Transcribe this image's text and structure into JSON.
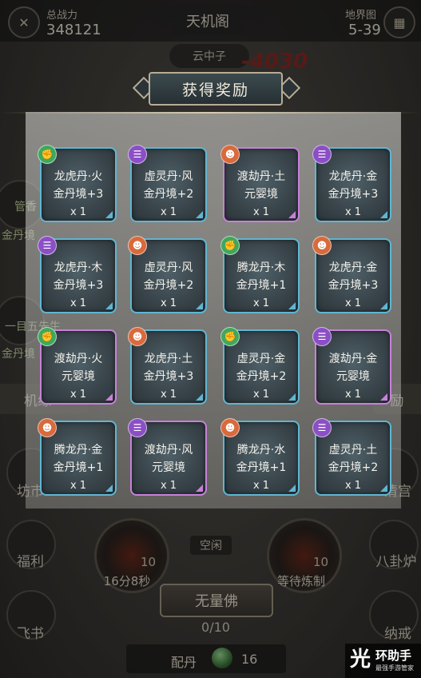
{
  "header": {
    "power_label": "总战力",
    "power_value": "348121",
    "title": "天机阁",
    "map_label": "地界图",
    "map_value": "5-39"
  },
  "scene": {
    "npc_name": "云中子",
    "damage": "-4030",
    "left_label_1": "管香",
    "left_label_2": "金丹境",
    "left_label_3": "一目五先生",
    "left_label_4": "金丹境",
    "bar_left": "机缘",
    "bar_right": "励",
    "side_left": [
      "坊市",
      "福利",
      "飞书"
    ],
    "side_right": [
      "清宫",
      "八卦炉",
      "纳戒"
    ],
    "furnace_left_count": "10",
    "furnace_left_timer": "16分8秒",
    "furnace_right_count": "10",
    "furnace_right_status": "等待炼制",
    "idle_label": "空闲",
    "action_button": "无量佛",
    "progress": "0/10",
    "peidan_label": "配丹",
    "peidan_count": "16"
  },
  "watermark": {
    "main": "环助手",
    "sub": "最强手游管家"
  },
  "reward": {
    "title": "获得奖励",
    "items": [
      {
        "name": "龙虎丹·火",
        "realm": "金丹境+3",
        "qty": "x 1",
        "frame": "blue",
        "badge": "green"
      },
      {
        "name": "虚灵丹·风",
        "realm": "金丹境+2",
        "qty": "x 1",
        "frame": "blue",
        "badge": "purple"
      },
      {
        "name": "渡劫丹·土",
        "realm": "元婴境",
        "qty": "x 1",
        "frame": "purple",
        "badge": "orange"
      },
      {
        "name": "龙虎丹·金",
        "realm": "金丹境+3",
        "qty": "x 1",
        "frame": "blue",
        "badge": "purple"
      },
      {
        "name": "龙虎丹·木",
        "realm": "金丹境+3",
        "qty": "x 1",
        "frame": "blue",
        "badge": "purple"
      },
      {
        "name": "虚灵丹·风",
        "realm": "金丹境+2",
        "qty": "x 1",
        "frame": "blue",
        "badge": "orange"
      },
      {
        "name": "腾龙丹·木",
        "realm": "金丹境+1",
        "qty": "x 1",
        "frame": "blue",
        "badge": "green"
      },
      {
        "name": "龙虎丹·金",
        "realm": "金丹境+3",
        "qty": "x 1",
        "frame": "blue",
        "badge": "orange"
      },
      {
        "name": "渡劫丹·火",
        "realm": "元婴境",
        "qty": "x 1",
        "frame": "purple",
        "badge": "green"
      },
      {
        "name": "龙虎丹·土",
        "realm": "金丹境+3",
        "qty": "x 1",
        "frame": "blue",
        "badge": "orange"
      },
      {
        "name": "虚灵丹·金",
        "realm": "金丹境+2",
        "qty": "x 1",
        "frame": "blue",
        "badge": "green"
      },
      {
        "name": "渡劫丹·金",
        "realm": "元婴境",
        "qty": "x 1",
        "frame": "purple",
        "badge": "purple"
      },
      {
        "name": "腾龙丹·金",
        "realm": "金丹境+1",
        "qty": "x 1",
        "frame": "blue",
        "badge": "orange"
      },
      {
        "name": "渡劫丹·风",
        "realm": "元婴境",
        "qty": "x 1",
        "frame": "purple",
        "badge": "purple"
      },
      {
        "name": "腾龙丹·水",
        "realm": "金丹境+1",
        "qty": "x 1",
        "frame": "blue",
        "badge": "orange"
      },
      {
        "name": "虚灵丹·土",
        "realm": "金丹境+2",
        "qty": "x 1",
        "frame": "blue",
        "badge": "purple"
      }
    ]
  },
  "colors": {
    "blue_frame": "#5fb6d2",
    "purple_frame": "#c781d9",
    "badge_green": "#3fa75e",
    "badge_purple": "#8b4fc5",
    "badge_orange": "#d86a3c"
  }
}
